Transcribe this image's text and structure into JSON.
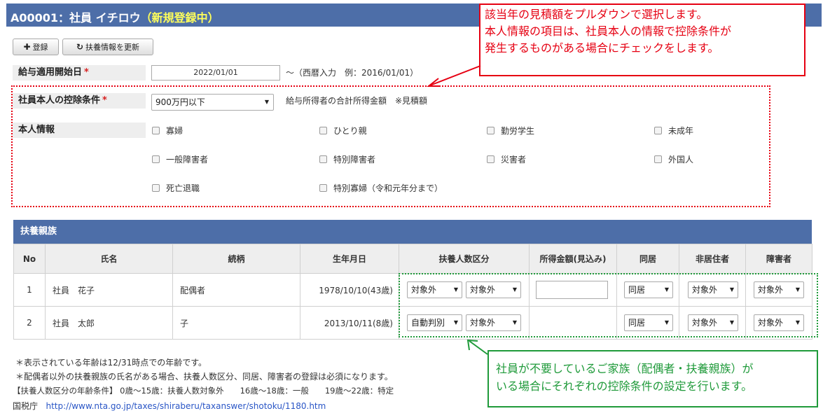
{
  "header": {
    "title": "A00001：社員 イチロウ",
    "status": "（新規登録中）"
  },
  "toolbar": {
    "register_label": "登録",
    "update_dependents_label": "扶養情報を更新"
  },
  "form": {
    "start_date_label": "給与適用開始日",
    "required_mark": "*",
    "start_date_value": "2022/01/01",
    "start_date_hint": "～（西暦入力　例：2016/01/01）",
    "deduction_label": "社員本人の控除条件",
    "deduction_value": "900万円以下",
    "deduction_hint": "給与所得者の合計所得金額　※見積額",
    "personal_info_label": "本人情報",
    "personal_options": [
      "寡婦",
      "ひとり親",
      "勤労学生",
      "未成年",
      "一般障害者",
      "特別障害者",
      "災害者",
      "外国人",
      "死亡退職",
      "特別寡婦（令和元年分まで）"
    ]
  },
  "dependents": {
    "section_title": "扶養親族",
    "headers": [
      "No",
      "氏名",
      "続柄",
      "生年月日",
      "扶養人数区分",
      "所得金額(見込み)",
      "同居",
      "非居住者",
      "障害者"
    ],
    "rows": [
      {
        "no": "1",
        "name": "社員　花子",
        "relation": "配偶者",
        "birth": "1978/10/10(43歳)",
        "category1": "対象外",
        "category2": "対象外",
        "income": "",
        "cohabit": "同居",
        "nonresident": "対象外",
        "disability": "対象外"
      },
      {
        "no": "2",
        "name": "社員　太郎",
        "relation": "子",
        "birth": "2013/10/11(8歳)",
        "category1": "自動判別",
        "category2": "対象外",
        "income": "",
        "cohabit": "同居",
        "nonresident": "対象外",
        "disability": "対象外"
      }
    ]
  },
  "notes": {
    "line1": "＊表示されている年齢は12/31時点での年齢です。",
    "line2": "＊配偶者以外の扶養親族の氏名がある場合、扶養人数区分、同居、障害者の登録は必須になります。",
    "line3": "【扶養人数区分の年齢条件】 0歳～15歳：扶養人数対象外　　16歳～18歳：一般　　19歳～22歳：特定",
    "tax_office_label": "国税庁",
    "tax_office_link": "http://www.nta.go.jp/taxes/shiraberu/taxanswer/shotoku/1180.htm"
  },
  "callouts": {
    "red_line1": "該当年の見積額をプルダウンで選択します。",
    "red_line2": "本人情報の項目は、社員本人の情報で控除条件が",
    "red_line3": "発生するものがある場合にチェックをします。",
    "green_line1": "社員が不要しているご家族（配偶者・扶養親族）が",
    "green_line2": "いる場合にそれぞれの控除条件の設定を行います。"
  },
  "icons": {
    "plus": "plus-icon",
    "refresh": "refresh-icon",
    "dropdown": "caret-down-icon"
  },
  "colors": {
    "header_bg": "#4d6ea8",
    "status_text": "#ffff5a",
    "required": "#d62020",
    "callout_red": "#e60012",
    "callout_green": "#1f9a3a"
  }
}
